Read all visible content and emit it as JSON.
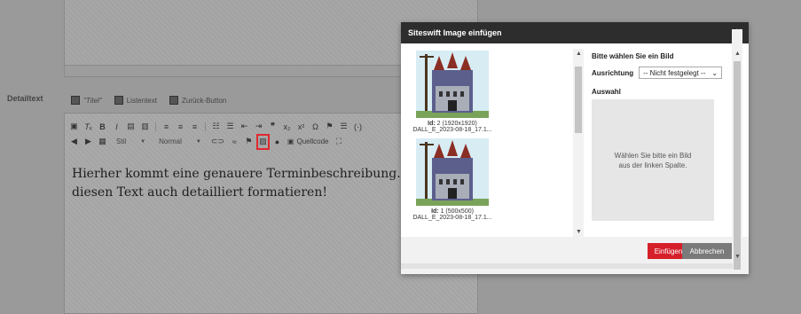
{
  "editor": {
    "field_label": "Detailtext",
    "chips": [
      "\"Titel\"",
      "Listentext",
      "Zurück-Button"
    ],
    "toolbar": {
      "style_combo": "Stil",
      "format_combo": "Normal",
      "source_label": "Quellcode"
    },
    "text_line1": "Hierher kommt eine genauere Terminbeschreibung. Wir kö",
    "text_line2": "diesen Text auch detailliert formatieren!"
  },
  "dialog": {
    "title": "Siteswift Image einfügen",
    "close": "×",
    "images": [
      {
        "id_label": "Id:",
        "id_value": "2 (1920x1920)",
        "filename": "DALL_E_2023-08-18_17.1..."
      },
      {
        "id_label": "Id:",
        "id_value": "1 (500x500)",
        "filename": "DALL_E_2023-08-18_17.1..."
      }
    ],
    "select_heading": "Bitte wählen Sie ein Bild",
    "align_label": "Ausrichtung",
    "align_value": "-- Nicht festgelegt --",
    "auswahl_label": "Auswahl",
    "preview_hint": "Wählen Sie bitte ein Bild aus der linken Spalte.",
    "insert_label": "Einfügen",
    "cancel_label": "Abbrechen"
  },
  "colors": {
    "dialog_header": "#2d2d2d",
    "insert_button": "#d5202b",
    "cancel_button": "#7a7a7a",
    "highlight": "#e0282f"
  }
}
